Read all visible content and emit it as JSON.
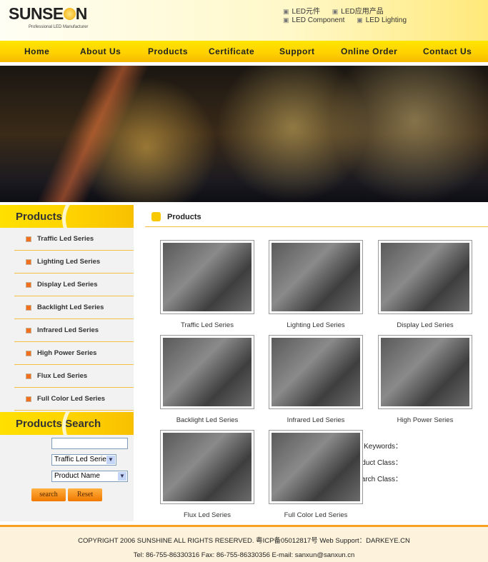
{
  "header": {
    "logo": "SUNSEON",
    "tagline": "Professional LED Manufacturer",
    "top_links": [
      "LED元件",
      "LED应用产品",
      "LED Component",
      "LED Lighting"
    ]
  },
  "nav": [
    "Home",
    "About Us",
    "Products",
    "Certificate",
    "Support",
    "Online Order",
    "Contact Us"
  ],
  "sidebar": {
    "title": "Products",
    "items": [
      "Traffic Led Series",
      "Lighting Led Series",
      "Display Led Series",
      "Backlight Led Series",
      "Infrared Led Series",
      "High Power Series",
      "Flux Led Series",
      "Full Color Led Series"
    ]
  },
  "search": {
    "title": "Products Search",
    "keywords_label": "Keywords：",
    "keywords_value": "",
    "class_label": "Product Class：",
    "class_value": "Traffic Led Series",
    "search_class_label": "Search Class：",
    "search_class_value": "Product Name",
    "search_btn": "search",
    "reset_btn": "Reset"
  },
  "main": {
    "title": "Products",
    "products": [
      "Traffic Led Series",
      "Lighting Led Series",
      "Display Led Series",
      "Backlight Led Series",
      "Infrared Led Series",
      "High Power Series",
      "Flux Led Series",
      "Full Color Led Series"
    ]
  },
  "footer": {
    "line1": "COPYRIGHT 2006 SUNSHINE ALL RIGHTS RESERVED. 粤ICP备05012817号  Web Support：DARKEYE.CN",
    "line2": "Tel: 86-755-86330316 Fax: 86-755-86330356 E-mail: sanxun@sanxun.cn"
  }
}
